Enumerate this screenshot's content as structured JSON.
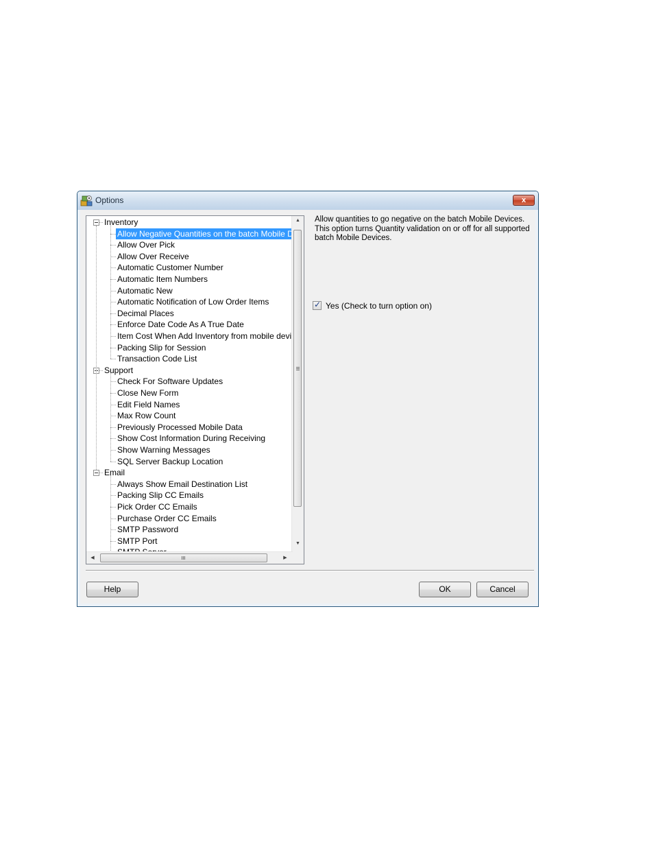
{
  "window": {
    "title": "Options",
    "close_glyph": "x",
    "icon": "options-app-icon"
  },
  "tree": {
    "groups": [
      {
        "label": "Inventory",
        "items": [
          "Allow Negative Quantities on the batch Mobile Devices",
          "Allow Over Pick",
          "Allow Over Receive",
          "Automatic Customer Number",
          "Automatic Item Numbers",
          "Automatic New",
          "Automatic Notification of Low Order Items",
          "Decimal Places",
          "Enforce Date Code As A True Date",
          "Item Cost When Add Inventory from mobile device",
          "Packing Slip for Session",
          "Transaction Code List"
        ]
      },
      {
        "label": "Support",
        "items": [
          "Check For Software Updates",
          "Close New Form",
          "Edit Field Names",
          "Max Row Count",
          "Previously Processed Mobile Data",
          "Show Cost Information During Receiving",
          "Show Warning Messages",
          "SQL Server Backup Location"
        ]
      },
      {
        "label": "Email",
        "items": [
          "Always Show Email Destination List",
          "Packing Slip CC Emails",
          "Pick Order CC Emails",
          "Purchase Order CC Emails",
          "SMTP Password",
          "SMTP Port",
          "SMTP Server"
        ]
      }
    ],
    "selected": "Allow Negative Quantities on the batch Mobile Devices"
  },
  "description": {
    "lines": [
      "Allow quantities to go negative on the batch Mobile Devices.",
      "This option turns Quantity validation on or off for all supported",
      "batch Mobile Devices."
    ]
  },
  "option": {
    "label": "Yes (Check to turn option on)",
    "checked": true
  },
  "buttons": {
    "help": "Help",
    "ok": "OK",
    "cancel": "Cancel"
  },
  "scrollbar": {
    "grip_glyph": "III",
    "up_glyph": "▲",
    "down_glyph": "▼",
    "left_glyph": "◀",
    "right_glyph": "▶"
  },
  "colors": {
    "selection": "#3399ff",
    "title_gradient_top": "#e9f1f9",
    "title_gradient_bottom": "#bfd3e8",
    "close_button": "#c23f22",
    "dialog_bg": "#f0f0f0"
  }
}
